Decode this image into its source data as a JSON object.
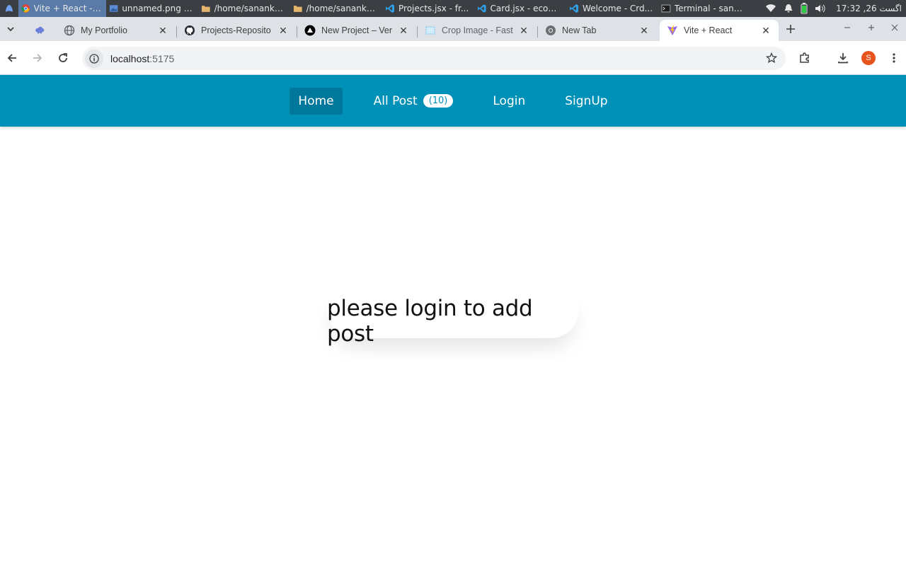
{
  "os_taskbar": {
    "tasks": [
      {
        "label": "Vite + React - G...",
        "icon": "chrome-icon",
        "active": true
      },
      {
        "label": "unnamed.png - ...",
        "icon": "image-viewer-icon",
        "active": false
      },
      {
        "label": "/home/sanankh...",
        "icon": "folder-icon",
        "active": false
      },
      {
        "label": "/home/sanankh...",
        "icon": "folder-icon",
        "active": false
      },
      {
        "label": "Projects.jsx - fr...",
        "icon": "vscode-icon",
        "active": false
      },
      {
        "label": "Card.jsx - ecom...",
        "icon": "vscode-icon",
        "active": false
      },
      {
        "label": "Welcome - Crd...",
        "icon": "vscode-icon",
        "active": false
      },
      {
        "label": "Terminal - sana...",
        "icon": "terminal-icon",
        "active": false
      }
    ],
    "clock": "17:32 ,26 اگست"
  },
  "browser": {
    "tabs": [
      {
        "title": "",
        "icon": "extension-icon",
        "pinned": true
      },
      {
        "title": "My Portfolio",
        "icon": "globe-icon"
      },
      {
        "title": "Projects-Reposito",
        "icon": "github-icon"
      },
      {
        "title": "New Project – Ver",
        "icon": "vercel-icon"
      },
      {
        "title": "Crop Image - Fast",
        "icon": "crop-icon"
      },
      {
        "title": "New Tab",
        "icon": "chrome-icon"
      },
      {
        "title": "Vite + React",
        "icon": "vite-icon",
        "active": true
      }
    ],
    "url_host": "localhost",
    "url_port": ":5175",
    "profile_initial": "S"
  },
  "navbar": {
    "items": [
      {
        "label": "Home",
        "active": true
      },
      {
        "label": "All Post",
        "badge": "(10)"
      },
      {
        "label": "Login"
      },
      {
        "label": "SignUp"
      }
    ]
  },
  "main": {
    "message": "please login to add post"
  },
  "colors": {
    "navbar_bg": "#0091b9",
    "navbar_active": "#00789c",
    "badge_text": "#0091b9"
  }
}
